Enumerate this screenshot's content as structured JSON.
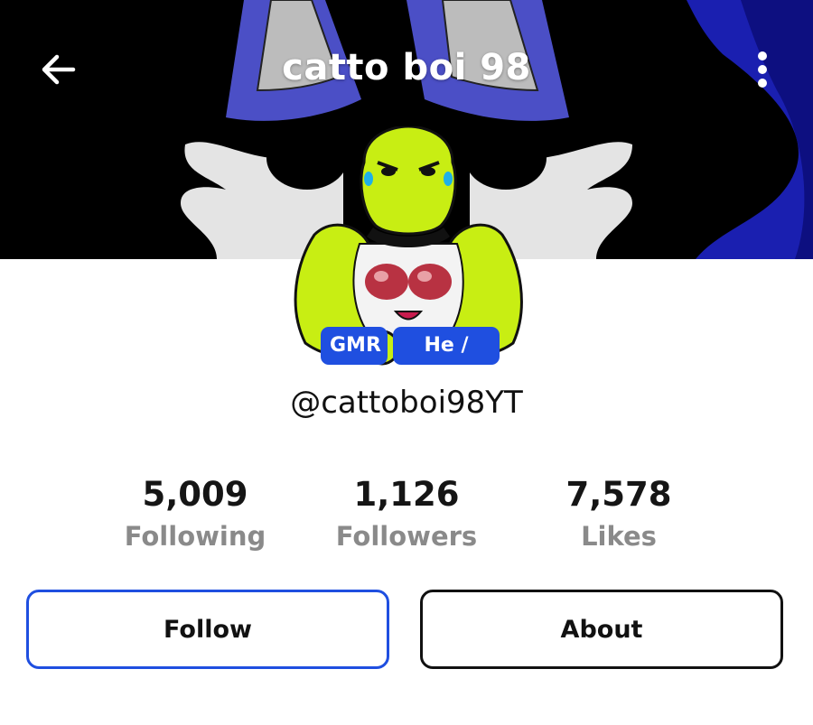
{
  "header": {
    "title": "catto boi 98",
    "back_icon": "arrow-left-icon",
    "menu_icon": "more-vertical-icon"
  },
  "profile": {
    "badges": [
      "GMR",
      "He / Him"
    ],
    "handle": "@cattoboi98YT",
    "avatar_icon": "avatar-frog-character"
  },
  "stats": [
    {
      "value": "5,009",
      "label": "Following"
    },
    {
      "value": "1,126",
      "label": "Followers"
    },
    {
      "value": "7,578",
      "label": "Likes"
    }
  ],
  "actions": {
    "follow_label": "Follow",
    "about_label": "About"
  },
  "colors": {
    "accent": "#1f4fe0",
    "banner_blue": "#2f3bd8",
    "avatar_green": "#c8ee13"
  }
}
